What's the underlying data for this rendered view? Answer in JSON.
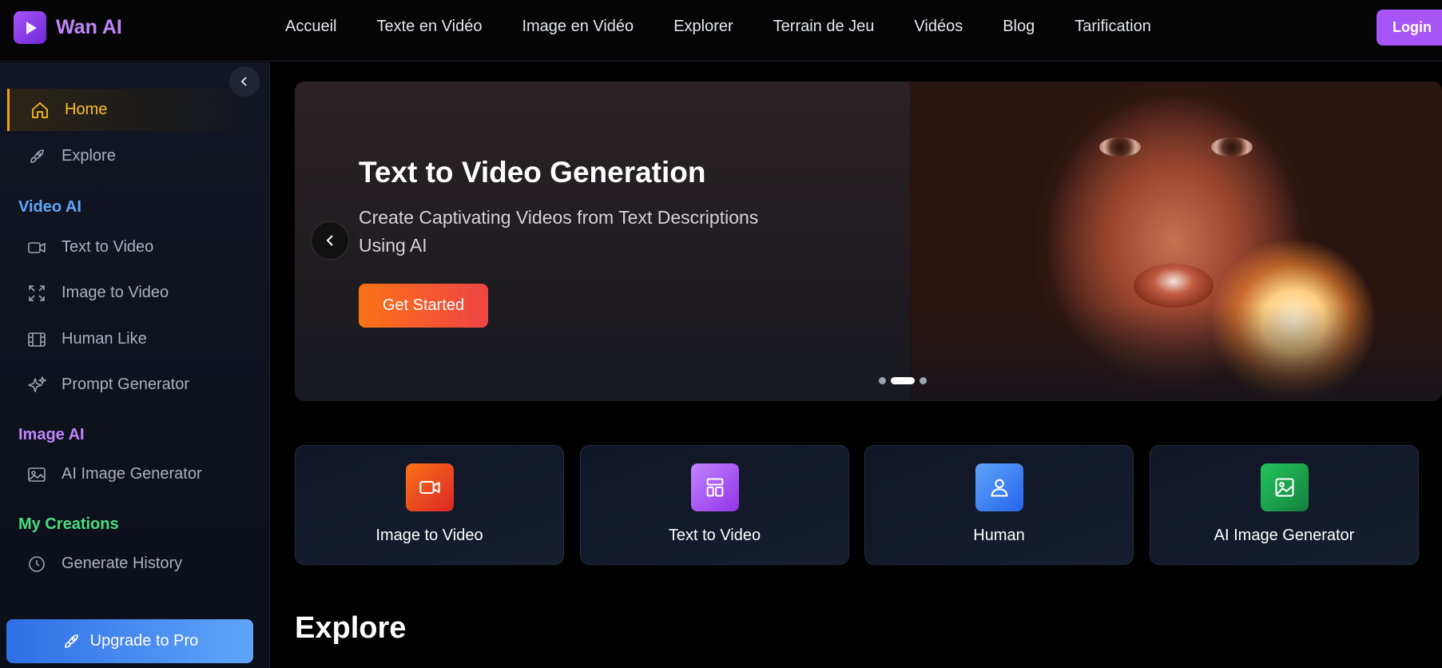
{
  "brand": {
    "name": "Wan AI"
  },
  "nav": {
    "items": [
      "Accueil",
      "Texte en Vidéo",
      "Image en Vidéo",
      "Explorer",
      "Terrain de Jeu",
      "Vidéos",
      "Blog",
      "Tarification"
    ],
    "login_label": "Login"
  },
  "sidebar": {
    "home": "Home",
    "explore": "Explore",
    "section_video": "Video AI",
    "text_to_video": "Text to Video",
    "image_to_video": "Image to Video",
    "human_like": "Human Like",
    "prompt_generator": "Prompt Generator",
    "section_image": "Image AI",
    "ai_image_generator": "AI Image Generator",
    "section_creations": "My Creations",
    "generate_history": "Generate History",
    "upgrade_label": "Upgrade to Pro"
  },
  "hero": {
    "title": "Text to Video Generation",
    "subtitle": "Create Captivating Videos from Text Descriptions Using AI",
    "cta": "Get Started",
    "slide_count": 3,
    "active_slide": 2
  },
  "cards": [
    {
      "label": "Image to Video",
      "icon": "video-camera-icon",
      "color": "#ea580c"
    },
    {
      "label": "Text to Video",
      "icon": "layout-icon",
      "color": "#a855f7"
    },
    {
      "label": "Human",
      "icon": "user-icon",
      "color": "#3b82f6"
    },
    {
      "label": "AI Image Generator",
      "icon": "image-icon",
      "color": "#16a34a"
    }
  ],
  "explore_heading": "Explore",
  "colors": {
    "accent_purple": "#a855f7",
    "active_amber": "#fbbf24",
    "section_video": "#60a5fa",
    "section_image": "#c084fc",
    "section_creations": "#4ade80"
  }
}
